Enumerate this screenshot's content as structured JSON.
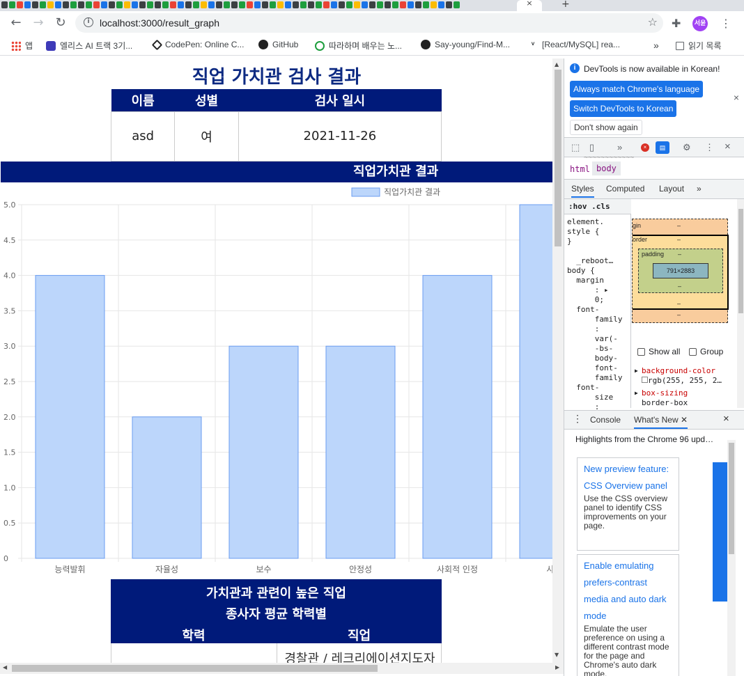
{
  "browser": {
    "active_tab_close": "×",
    "new_tab": "+",
    "url": "localhost:3000/result_graph",
    "avatar_text": "서윤",
    "bookmarks": [
      {
        "label": "앱",
        "icon": "apps-grid-icon"
      },
      {
        "label": "엘리스 AI 트랙 3기...",
        "icon": "elice-icon"
      },
      {
        "label": "CodePen: Online C...",
        "icon": "codepen-icon"
      },
      {
        "label": "GitHub",
        "icon": "github-icon"
      },
      {
        "label": "따라하며 배우는 노...",
        "icon": "leaf-icon"
      },
      {
        "label": "Say-young/Find-M...",
        "icon": "github-icon"
      },
      {
        "label": "[React/MySQL] rea...",
        "icon": "velog-icon"
      }
    ],
    "bookmarks_overflow": "»",
    "reading_list": "읽기 목록"
  },
  "page": {
    "title": "직업 가치관 검사 결과",
    "info_table": {
      "headers": [
        "이름",
        "성별",
        "검사 일시"
      ],
      "values": [
        "asd",
        "여",
        "2021-11-26"
      ]
    },
    "result_banner": "직업가치관 결과",
    "jobs": {
      "title_line1": "가치관과 관련이 높은 직업",
      "title_line2": "종사자 평균 학력별",
      "col_education": "학력",
      "col_job": "직업",
      "row1_job": "경찰관 / 레크리에이션지도자"
    }
  },
  "chart_data": {
    "type": "bar",
    "legend": "직업가치관 결과",
    "legend_position": "top",
    "categories": [
      "능력발휘",
      "자율성",
      "보수",
      "안정성",
      "사회적 인정",
      "사회"
    ],
    "values": [
      4,
      2,
      3,
      3,
      4,
      5
    ],
    "yticks": [
      "0",
      "0.5",
      "1.0",
      "1.5",
      "2.0",
      "2.5",
      "3.0",
      "3.5",
      "4.0",
      "4.5",
      "5.0"
    ],
    "ylim": [
      0,
      5
    ],
    "grid": true,
    "colors": {
      "bar_fill": "#bcd6fb",
      "bar_stroke": "#6a9cf0",
      "grid": "#e6e6e6"
    }
  },
  "devtools": {
    "info_message": "DevTools is now available in Korean!",
    "btn_match": "Always match Chrome's language",
    "btn_switch": "Switch DevTools to Korean",
    "btn_dont_show": "Don't show again",
    "crumb_html": "html",
    "crumb_body": "body",
    "tab_styles": "Styles",
    "tab_computed": "Computed",
    "tab_layout": "Layout",
    "more": "»",
    "hov_cls": ":hov  .cls",
    "styles_code": "element.\nstyle {\n}\n\n  _reboot…\nbody {\n  margin\n      : ▸\n      0;\n  font-\n      family\n      :\n      var(-\n      -bs-\n      body-\n      font-\n      family\n  font-\n      size\n      :",
    "box_margin_label": "gin",
    "box_border_label": "order",
    "box_padding_label": "padding",
    "box_dash": "–",
    "box_content": "791×2883",
    "show_all": "Show all",
    "group": "Group",
    "computed_prop1": "background-color",
    "computed_val1": "rgb(255, 255, 2…",
    "computed_prop2": "box-sizing",
    "computed_val2": "border-box",
    "drawer_console": "Console",
    "drawer_whats_new": "What's New",
    "whats_new_heading": "Highlights from the Chrome 96 upd…",
    "card1_link": "New preview feature: CSS Overview panel",
    "card1_desc": "Use the CSS overview panel to identify CSS improvements on your page.",
    "card2_link": "Enable emulating prefers-contrast media and auto dark mode",
    "card2_desc": "Emulate the user preference on using a different contrast mode for the page and Chrome's auto dark mode."
  }
}
